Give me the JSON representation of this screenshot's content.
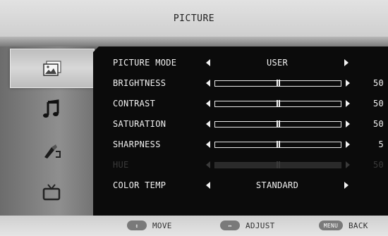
{
  "header": {
    "title": "PICTURE"
  },
  "sidebar": {
    "tabs": [
      {
        "icon": "picture-icon",
        "active": true
      },
      {
        "icon": "music-note-icon",
        "active": false
      },
      {
        "icon": "setup-tools-icon",
        "active": false
      },
      {
        "icon": "tv-icon",
        "active": false
      }
    ]
  },
  "menu": {
    "picture_mode": {
      "label": "PICTURE MODE",
      "value": "USER"
    },
    "brightness": {
      "label": "BRIGHTNESS",
      "value": "50",
      "level": 0.5
    },
    "contrast": {
      "label": "CONTRAST",
      "value": "50",
      "level": 0.5
    },
    "saturation": {
      "label": "SATURATION",
      "value": "50",
      "level": 0.5
    },
    "sharpness": {
      "label": "SHARPNESS",
      "value": "5",
      "level": 0.5
    },
    "hue": {
      "label": "HUE",
      "value": "50",
      "level": 0.5,
      "disabled": true
    },
    "color_temp": {
      "label": "COLOR TEMP",
      "value": "STANDARD"
    }
  },
  "footer": {
    "move": {
      "key": "↕",
      "label": "MOVE"
    },
    "adjust": {
      "key": "↔",
      "label": "ADJUST"
    },
    "back": {
      "key": "MENU",
      "label": "BACK"
    }
  },
  "colors": {
    "panel": "#0b0b0b",
    "text": "#f2f2f2",
    "disabled_text": "#3a3a3a",
    "chrome": "#cfcfcf"
  }
}
